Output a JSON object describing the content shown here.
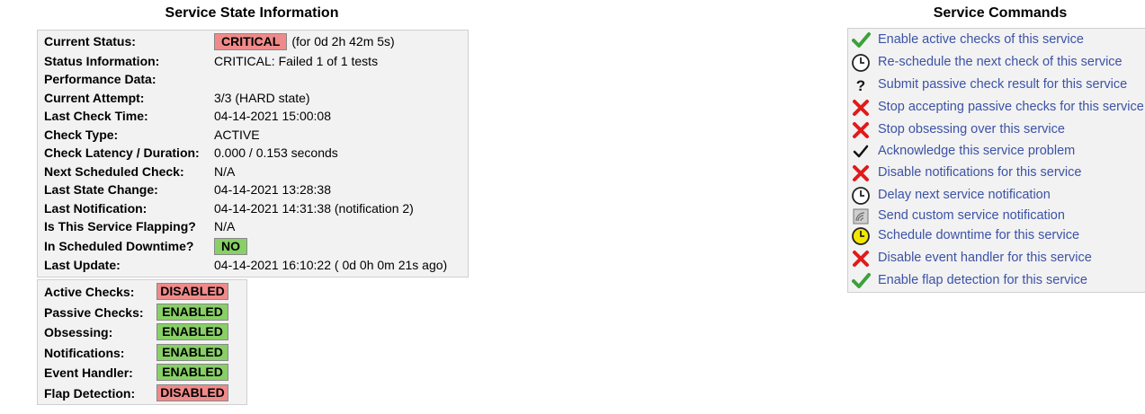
{
  "state_section": {
    "title": "Service State Information",
    "rows": [
      {
        "label": "Current Status:",
        "badge": "CRITICAL",
        "badge_color": "#f08a8a",
        "value": "(for 0d 2h 42m 5s)"
      },
      {
        "label": "Status Information:",
        "value": "CRITICAL: Failed 1 of 1 tests"
      },
      {
        "label": "Performance Data:",
        "value": ""
      },
      {
        "label": "Current Attempt:",
        "value": "3/3  (HARD state)"
      },
      {
        "label": "Last Check Time:",
        "value": "04-14-2021 15:00:08"
      },
      {
        "label": "Check Type:",
        "value": "ACTIVE"
      },
      {
        "label": "Check Latency / Duration:",
        "value": "0.000 / 0.153 seconds"
      },
      {
        "label": "Next Scheduled Check:",
        "value": "N/A"
      },
      {
        "label": "Last State Change:",
        "value": "04-14-2021 13:28:38"
      },
      {
        "label": "Last Notification:",
        "value": "04-14-2021 14:31:38 (notification 2)"
      },
      {
        "label": "Is This Service Flapping?",
        "value": "N/A"
      },
      {
        "label": "In Scheduled Downtime?",
        "badge": "NO",
        "badge_color": "#88d066",
        "value": ""
      },
      {
        "label": "Last Update:",
        "value": "04-14-2021 16:10:22  ( 0d 0h 0m 21s ago)"
      }
    ]
  },
  "flags_section": {
    "rows": [
      {
        "label": "Active Checks:",
        "value": "DISABLED",
        "color": "#f08a8a"
      },
      {
        "label": "Passive Checks:",
        "value": "ENABLED",
        "color": "#88d066"
      },
      {
        "label": "Obsessing:",
        "value": "ENABLED",
        "color": "#88d066"
      },
      {
        "label": "Notifications:",
        "value": "ENABLED",
        "color": "#88d066"
      },
      {
        "label": "Event Handler:",
        "value": "ENABLED",
        "color": "#88d066"
      },
      {
        "label": "Flap Detection:",
        "value": "DISABLED",
        "color": "#f08a8a"
      }
    ]
  },
  "commands_section": {
    "title": "Service Commands",
    "commands": [
      {
        "label": "Enable active checks of this service",
        "icon": "green-check-icon"
      },
      {
        "label": "Re-schedule the next check of this service",
        "icon": "clock-icon"
      },
      {
        "label": "Submit passive check result for this service",
        "icon": "question-icon"
      },
      {
        "label": "Stop accepting passive checks for this service",
        "icon": "red-x-icon"
      },
      {
        "label": "Stop obsessing over this service",
        "icon": "red-x-icon"
      },
      {
        "label": "Acknowledge this service problem",
        "icon": "black-check-icon"
      },
      {
        "label": "Disable notifications for this service",
        "icon": "red-x-icon"
      },
      {
        "label": "Delay next service notification",
        "icon": "clock-icon"
      },
      {
        "label": "Send custom service notification",
        "icon": "notify-icon"
      },
      {
        "label": "Schedule downtime for this service",
        "icon": "yellow-clock-icon"
      },
      {
        "label": "Disable event handler for this service",
        "icon": "red-x-icon"
      },
      {
        "label": "Enable flap detection for this service",
        "icon": "green-check-icon"
      }
    ]
  },
  "colors": {
    "critical": "#f08a8a",
    "ok": "#88d066",
    "link": "#3c52a6"
  }
}
